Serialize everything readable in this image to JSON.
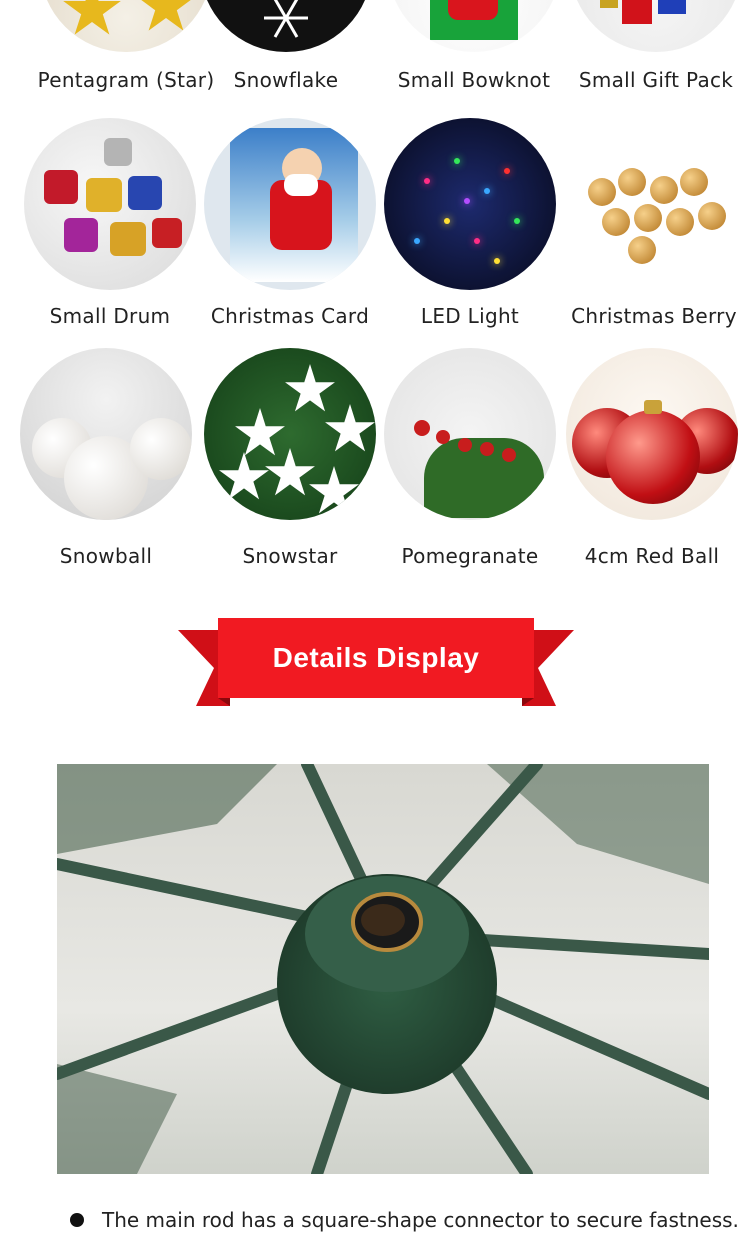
{
  "products": {
    "row1": [
      "Pentagram (Star)",
      "Snowflake",
      "Small Bowknot",
      "Small Gift Pack"
    ],
    "row2": [
      "Small Drum",
      "Christmas Card",
      "LED Light",
      "Christmas Berry"
    ],
    "row3": [
      "Snowball",
      "Snowstar",
      "Pomegranate",
      "4cm Red Ball"
    ]
  },
  "banner": {
    "title": "Details Display",
    "color": "#e8101a"
  },
  "detail": {
    "caption": "The main rod has a square-shape connector to secure fastness."
  }
}
